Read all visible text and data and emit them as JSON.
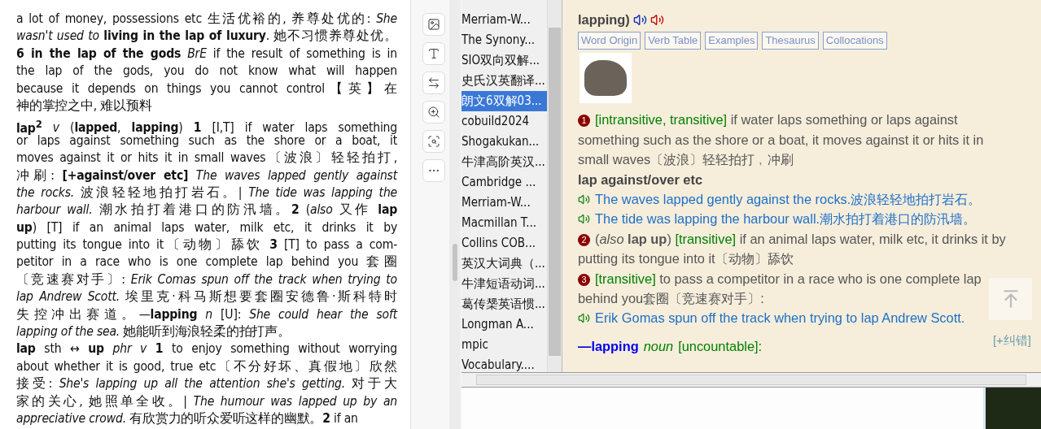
{
  "document": {
    "entries": [
      {
        "lines": [
          "a lot of money, possessions etc 生活优裕的, 养尊处优的: *She*",
          "*wasn't used to* **living in the lap of luxury**. 她不习惯养尊处优。",
          "**6 in the lap of the gods** *BrE* if the result of something is in",
          "the lap of the gods, you do not know what will happen",
          "because it depends on things you cannot control【英】在",
          "神的掌控之中, 难以预料"
        ]
      },
      {
        "lines": [
          "**lap$^{2}$** *v* (**lapped**, **lapping**) **1** [I,T] if water laps something",
          "or laps against something such as the shore or a boat, it",
          "moves against it or hits it in small waves〔波浪〕轻轻拍打,",
          "冲刷: **[+against/over etc]** *The waves lapped gently against*",
          "*the rocks.* 波浪轻轻地拍打岩石。| *The tide was lapping the*",
          "*harbour wall.* 潮水拍打着港口的防汛墙。**2** (*also* 又作 **lap**",
          "**up**) [T] if an animal laps water, milk etc, it drinks it by",
          "putting its tongue into it〔动物〕舔饮 **3** [T] to pass a com-",
          "petitor in a race who is one complete lap behind you 套圈",
          "〔竞速赛对手〕: *Erik Comas spun off the track when trying to*",
          "*lap Andrew Scott.* 埃里克·科马斯想要套圈安德鲁·斯科特时",
          "失控冲出赛道。—**lapping** *n* [U]: *She could hear the soft*",
          "*lapping of the sea.* 她能听到海浪轻柔的拍打声。"
        ]
      },
      {
        "lines": [
          "**lap** sth ↔ **up** *phr v* **1** to enjoy something without worrying",
          "about whether it is good, true etc〔不分好坏、真假地〕欣然",
          "接受: *She's lapping up all the attention she's getting.* 对于大",
          "家的关心, 她照单全收。| *The humour was lapped up by an*",
          "*appreciative crowd.* 有欣赏力的听众爱听这样的幽默。**2** if an"
        ]
      }
    ]
  },
  "dictionaries": [
    {
      "label": "Merriam-W...",
      "selected": false
    },
    {
      "label": "The Synony...",
      "selected": false
    },
    {
      "label": "SIO双向双解...",
      "selected": false
    },
    {
      "label": "史氏汉英翻译...",
      "selected": false
    },
    {
      "label": "朗文6双解03...",
      "selected": true
    },
    {
      "label": "cobuild2024",
      "selected": false
    },
    {
      "label": "Shogakukan...",
      "selected": false
    },
    {
      "label": "牛津高阶英汉...",
      "selected": false
    },
    {
      "label": "Cambridge ...",
      "selected": false
    },
    {
      "label": "Merriam-W...",
      "selected": false
    },
    {
      "label": "Macmillan T...",
      "selected": false
    },
    {
      "label": "Collins COB...",
      "selected": false
    },
    {
      "label": "英汉大词典（...",
      "selected": false
    },
    {
      "label": "牛津短语动词...",
      "selected": false
    },
    {
      "label": "葛传椝英语惯...",
      "selected": false
    },
    {
      "label": "Longman A...",
      "selected": false
    },
    {
      "label": "mpic",
      "selected": false
    },
    {
      "label": "Vocabulary....",
      "selected": false
    }
  ],
  "entry": {
    "headword_tail": "**lapping**)",
    "tags": [
      "Word Origin",
      "Verb Table",
      "Examples",
      "Thesaurus",
      "Collocations"
    ],
    "senses": [
      {
        "number": "1",
        "grammar": "[intransitive, transitive]",
        "definition": "if water laps something or laps against something such as the shore or a boat, it moves against it or hits it in small waves〔波浪〕轻轻拍打﹐冲刷",
        "pattern": "lap against/over etc",
        "examples": [
          "The waves lapped gently against the rocks.波浪轻轻地拍打岩石。",
          "The tide was lapping the harbour wall.潮水拍打着港口的防汛墙。"
        ]
      },
      {
        "number": "2",
        "prefix": "(*also* **lap up**)",
        "grammar": "[transitive]",
        "definition": "if an animal laps water, milk etc, it drinks it by putting its tongue into it〔动物〕舔饮"
      },
      {
        "number": "3",
        "grammar": "[transitive]",
        "definition": "to pass a competitor in a race who is one complete lap behind you套圈〔竞速赛对手〕:",
        "examples": [
          "Erik Gomas spun off the track when trying to lap Andrew Scott."
        ]
      }
    ],
    "derived": {
      "word": "—lapping",
      "pos": "noun",
      "grammar": "[uncountable]:"
    },
    "correction_link": "[+纠错]"
  }
}
